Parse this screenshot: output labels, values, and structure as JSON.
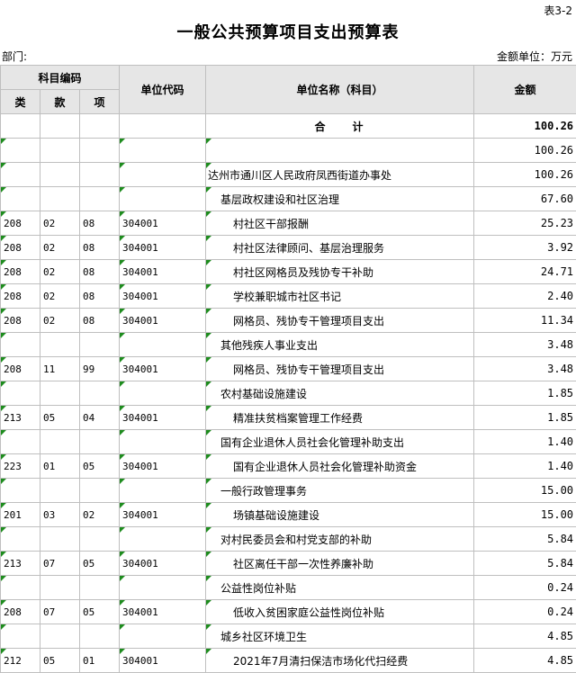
{
  "header": {
    "table_no": "表3-2",
    "title": "一般公共预算项目支出预算表",
    "dept_label": "部门:",
    "unit_label": "金额单位：万元"
  },
  "columns": {
    "subject_code": "科目编码",
    "lei": "类",
    "kuan": "款",
    "xiang": "项",
    "unit_code": "单位代码",
    "unit_name": "单位名称（科目）",
    "amount": "金额"
  },
  "total": {
    "label": "合　　计",
    "amount": "100.26"
  },
  "rows": [
    {
      "lei": "",
      "kuan": "",
      "xiang": "",
      "code": "",
      "name": "",
      "level": 1,
      "amount": "100.26"
    },
    {
      "lei": "",
      "kuan": "",
      "xiang": "",
      "code": "",
      "name": "达州市通川区人民政府凤西街道办事处",
      "level": 1,
      "amount": "100.26"
    },
    {
      "lei": "",
      "kuan": "",
      "xiang": "",
      "code": "",
      "name": "基层政权建设和社区治理",
      "level": 2,
      "amount": "67.60"
    },
    {
      "lei": "208",
      "kuan": "02",
      "xiang": "08",
      "code": "304001",
      "name": "村社区干部报酬",
      "level": 3,
      "amount": "25.23"
    },
    {
      "lei": "208",
      "kuan": "02",
      "xiang": "08",
      "code": "304001",
      "name": "村社区法律顾问、基层治理服务",
      "level": 3,
      "amount": "3.92"
    },
    {
      "lei": "208",
      "kuan": "02",
      "xiang": "08",
      "code": "304001",
      "name": "村社区网格员及残协专干补助",
      "level": 3,
      "amount": "24.71"
    },
    {
      "lei": "208",
      "kuan": "02",
      "xiang": "08",
      "code": "304001",
      "name": "学校兼职城市社区书记",
      "level": 3,
      "amount": "2.40"
    },
    {
      "lei": "208",
      "kuan": "02",
      "xiang": "08",
      "code": "304001",
      "name": "网格员、残协专干管理项目支出",
      "level": 3,
      "amount": "11.34"
    },
    {
      "lei": "",
      "kuan": "",
      "xiang": "",
      "code": "",
      "name": "其他残疾人事业支出",
      "level": 2,
      "amount": "3.48"
    },
    {
      "lei": "208",
      "kuan": "11",
      "xiang": "99",
      "code": "304001",
      "name": "网格员、残协专干管理项目支出",
      "level": 3,
      "amount": "3.48"
    },
    {
      "lei": "",
      "kuan": "",
      "xiang": "",
      "code": "",
      "name": "农村基础设施建设",
      "level": 2,
      "amount": "1.85"
    },
    {
      "lei": "213",
      "kuan": "05",
      "xiang": "04",
      "code": "304001",
      "name": "精准扶贫档案管理工作经费",
      "level": 3,
      "amount": "1.85"
    },
    {
      "lei": "",
      "kuan": "",
      "xiang": "",
      "code": "",
      "name": "国有企业退休人员社会化管理补助支出",
      "level": 2,
      "amount": "1.40"
    },
    {
      "lei": "223",
      "kuan": "01",
      "xiang": "05",
      "code": "304001",
      "name": "国有企业退休人员社会化管理补助资金",
      "level": 3,
      "amount": "1.40"
    },
    {
      "lei": "",
      "kuan": "",
      "xiang": "",
      "code": "",
      "name": "一般行政管理事务",
      "level": 2,
      "amount": "15.00"
    },
    {
      "lei": "201",
      "kuan": "03",
      "xiang": "02",
      "code": "304001",
      "name": "场镇基础设施建设",
      "level": 3,
      "amount": "15.00"
    },
    {
      "lei": "",
      "kuan": "",
      "xiang": "",
      "code": "",
      "name": "对村民委员会和村党支部的补助",
      "level": 2,
      "amount": "5.84"
    },
    {
      "lei": "213",
      "kuan": "07",
      "xiang": "05",
      "code": "304001",
      "name": "社区离任干部一次性养廉补助",
      "level": 3,
      "amount": "5.84"
    },
    {
      "lei": "",
      "kuan": "",
      "xiang": "",
      "code": "",
      "name": "公益性岗位补贴",
      "level": 2,
      "amount": "0.24"
    },
    {
      "lei": "208",
      "kuan": "07",
      "xiang": "05",
      "code": "304001",
      "name": "低收入贫困家庭公益性岗位补贴",
      "level": 3,
      "amount": "0.24"
    },
    {
      "lei": "",
      "kuan": "",
      "xiang": "",
      "code": "",
      "name": "城乡社区环境卫生",
      "level": 2,
      "amount": "4.85"
    },
    {
      "lei": "212",
      "kuan": "05",
      "xiang": "01",
      "code": "304001",
      "name": "2021年7月清扫保洁市场化代扫经费",
      "level": 3,
      "amount": "4.85"
    }
  ]
}
